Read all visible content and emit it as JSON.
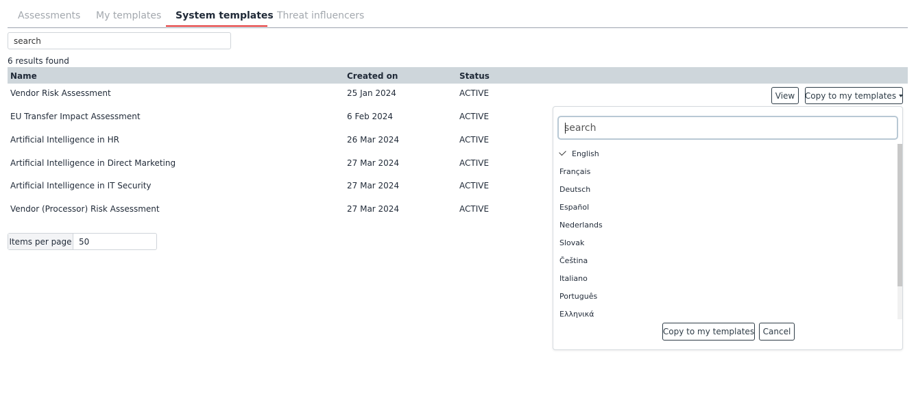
{
  "tabs": [
    {
      "label": "Assessments"
    },
    {
      "label": "My templates"
    },
    {
      "label": "System templates"
    },
    {
      "label": "Threat influencers"
    }
  ],
  "search": {
    "placeholder": "search"
  },
  "results_text": "6 results found",
  "table": {
    "headers": {
      "name": "Name",
      "created": "Created on",
      "status": "Status"
    },
    "rows": [
      {
        "name": "Vendor Risk Assessment",
        "created": "25 Jan 2024",
        "status": "ACTIVE"
      },
      {
        "name": "EU Transfer Impact Assessment",
        "created": "6 Feb 2024",
        "status": "ACTIVE"
      },
      {
        "name": "Artificial Intelligence in HR",
        "created": "26 Mar 2024",
        "status": "ACTIVE"
      },
      {
        "name": "Artificial Intelligence in Direct Marketing",
        "created": "27 Mar 2024",
        "status": "ACTIVE"
      },
      {
        "name": "Artificial Intelligence in IT Security",
        "created": "27 Mar 2024",
        "status": "ACTIVE"
      },
      {
        "name": "Vendor (Processor) Risk Assessment",
        "created": "27 Mar 2024",
        "status": "ACTIVE"
      }
    ]
  },
  "actions": {
    "view_label": "View",
    "copy_label": "Copy to my templates"
  },
  "pagination": {
    "label": "Items per page",
    "value": "50"
  },
  "dropdown": {
    "search_placeholder": "search",
    "languages": [
      {
        "label": "English",
        "selected": true
      },
      {
        "label": "Français"
      },
      {
        "label": "Deutsch"
      },
      {
        "label": "Español"
      },
      {
        "label": "Nederlands"
      },
      {
        "label": "Slovak"
      },
      {
        "label": "Čeština"
      },
      {
        "label": "Italiano"
      },
      {
        "label": "Português"
      },
      {
        "label": "Ελληνικά"
      }
    ],
    "copy_label": "Copy to my templates",
    "cancel_label": "Cancel"
  },
  "colors": {
    "active_tab_underline": "#e03535",
    "table_header_bg": "#ced6db",
    "button_border": "#2d3b46"
  }
}
